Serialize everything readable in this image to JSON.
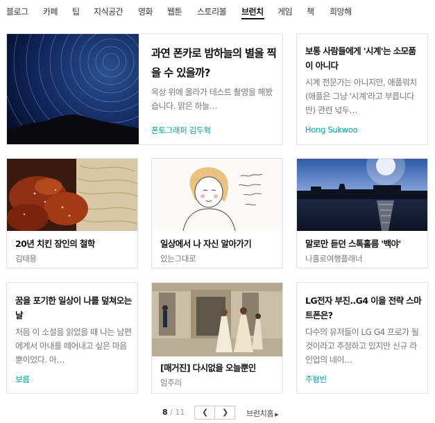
{
  "nav": {
    "items": [
      "블로그",
      "카페",
      "팁",
      "지식공간",
      "영화",
      "웹툰",
      "스토리볼",
      "브런치",
      "게임",
      "책",
      "희망해"
    ],
    "active_index": 7
  },
  "cards": [
    {
      "title": "과연 폰카로 밤하늘의 별을 찍을 수 있을까?",
      "desc": "옥상 위에 올라가 테스트 촬영을 해봤습니다. 맑은 하늘…",
      "author": "폰토그래퍼 김두혁"
    },
    {
      "title": "보통 사람들에게 '시계'는 소모품이 아니다",
      "desc": "시계 전문가는 아니지만, 애플워치(애플은 그냥 '시계'라고 부릅니다만) 관련 넋두…",
      "author": "Hong Sukwoo"
    },
    {
      "title": "20년 치킨 장인의 철학",
      "author": "김태용"
    },
    {
      "title": "일상에서 나 자신 알아가기",
      "author": "있는그대로"
    },
    {
      "title": "말로만 듣던 스톡홀름 '백야'",
      "author": "나홀로여행플래너"
    },
    {
      "title": "꿈을 포기한 일상이 나를 덮쳐오는 날",
      "desc": "처음 이 소설을 읽었을 때 나는 남편에게서 아내를 떼어내고 싶은 마음뿐이었다. 아…",
      "author": "보름"
    },
    {
      "title": "[매거진] 다시없을 오늘뿐인",
      "author": "임주리"
    },
    {
      "title": "LG전자 부진..G4 이을 전략 스마트폰은?",
      "desc": "다수의 유저들이 LG G4 프로가 될 것이라고 추정하고 있지만 신규 라인업의 네이…",
      "author": "주형빈"
    }
  ],
  "pager": {
    "current": "8",
    "separator": "/",
    "total": "11",
    "prev_icon": "chevron-left-icon",
    "next_icon": "chevron-right-icon",
    "home_label": "브런치홈"
  },
  "colors": {
    "accent_teal": "#00a0a0",
    "border": "#e2e2e2"
  }
}
